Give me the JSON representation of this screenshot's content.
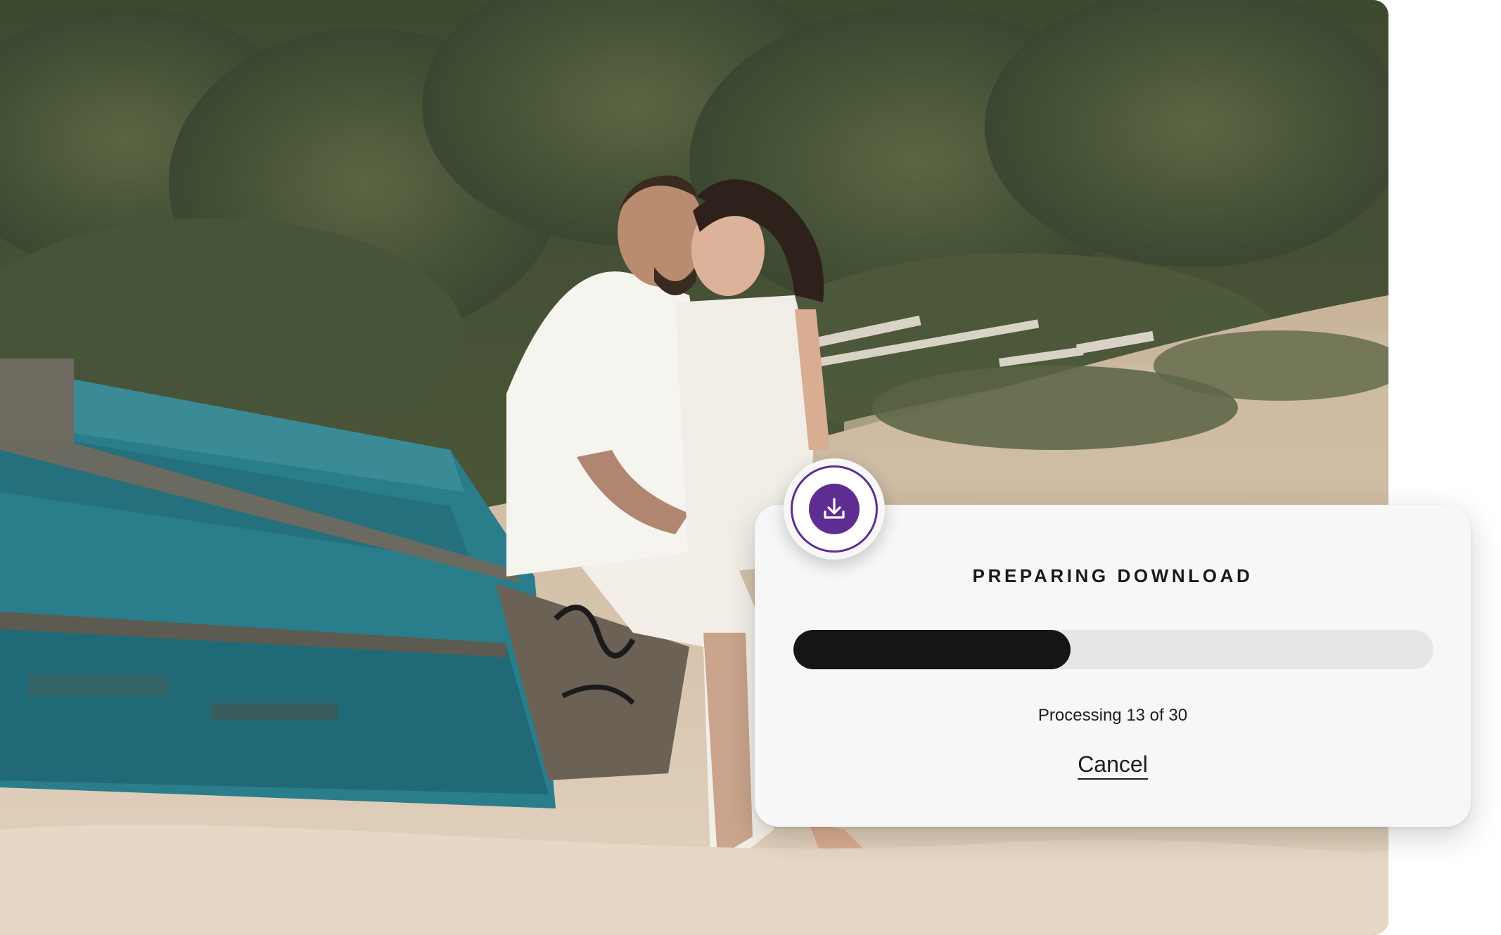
{
  "photo": {
    "subject": "couple-on-boat"
  },
  "download_dialog": {
    "icon": "download-icon",
    "title": "PREPARING DOWNLOAD",
    "progress": {
      "current": 13,
      "total": 30
    },
    "status_text": "Processing 13 of 30",
    "cancel_label": "Cancel",
    "colors": {
      "accent": "#5e2d91",
      "progress_fill": "#151515",
      "progress_track": "#e6e6e6",
      "card_background": "#f7f7f7"
    }
  }
}
